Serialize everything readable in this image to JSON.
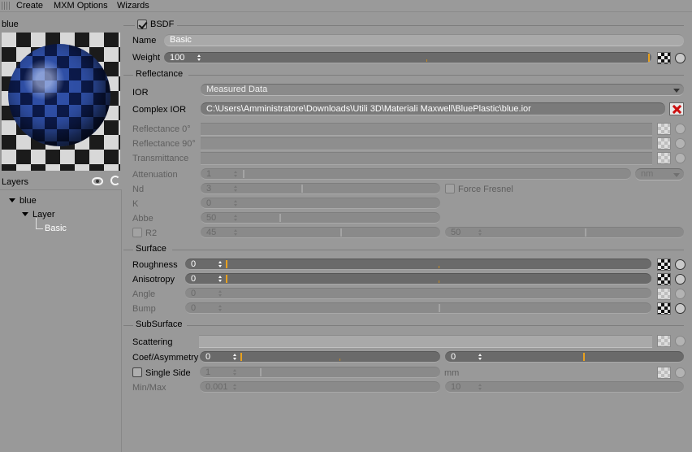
{
  "menu": {
    "items": [
      "Create",
      "MXM Options",
      "Wizards"
    ]
  },
  "left": {
    "title": "blue",
    "layers_label": "Layers",
    "tree": {
      "root": "blue",
      "layer": "Layer",
      "item": "Basic"
    }
  },
  "bsdf": {
    "title": "BSDF",
    "enabled": true,
    "name_label": "Name",
    "name_value": "Basic",
    "weight_label": "Weight",
    "weight_value": "100",
    "weight_fraction": 1.0
  },
  "reflectance": {
    "title": "Reflectance",
    "ior_label": "IOR",
    "ior_mode": "Measured Data",
    "complex_ior_label": "Complex IOR",
    "complex_ior_path": "C:\\Users\\Amministratore\\Downloads\\Utili 3D\\Materiali Maxwell\\BluePlastic\\blue.ior",
    "reflectance0_label": "Reflectance 0°",
    "reflectance90_label": "Reflectance 90°",
    "transmittance_label": "Transmittance",
    "attenuation_label": "Attenuation",
    "attenuation_value": "1",
    "attenuation_unit": "nm",
    "nd_label": "Nd",
    "nd_value": "3",
    "force_fresnel_label": "Force Fresnel",
    "k_label": "K",
    "k_value": "0",
    "abbe_label": "Abbe",
    "abbe_value": "50",
    "r2_label": "R2",
    "r2_value_a": "45",
    "r2_value_b": "50"
  },
  "surface": {
    "title": "Surface",
    "roughness_label": "Roughness",
    "roughness_value": "0",
    "anisotropy_label": "Anisotropy",
    "anisotropy_value": "0",
    "angle_label": "Angle",
    "angle_value": "0",
    "bump_label": "Bump",
    "bump_value": "0"
  },
  "subsurface": {
    "title": "SubSurface",
    "scattering_label": "Scattering",
    "coef_label": "Coef/Asymmetry",
    "coef_value": "0",
    "asym_value": "0",
    "single_side_label": "Single Side",
    "single_side_value": "1",
    "single_side_unit": "mm",
    "minmax_label": "Min/Max",
    "min_value": "0.001",
    "max_value": "10"
  },
  "colors": {
    "accent_thumb": "#e8a11e",
    "close_red": "#cc1010",
    "background": "#999999"
  }
}
